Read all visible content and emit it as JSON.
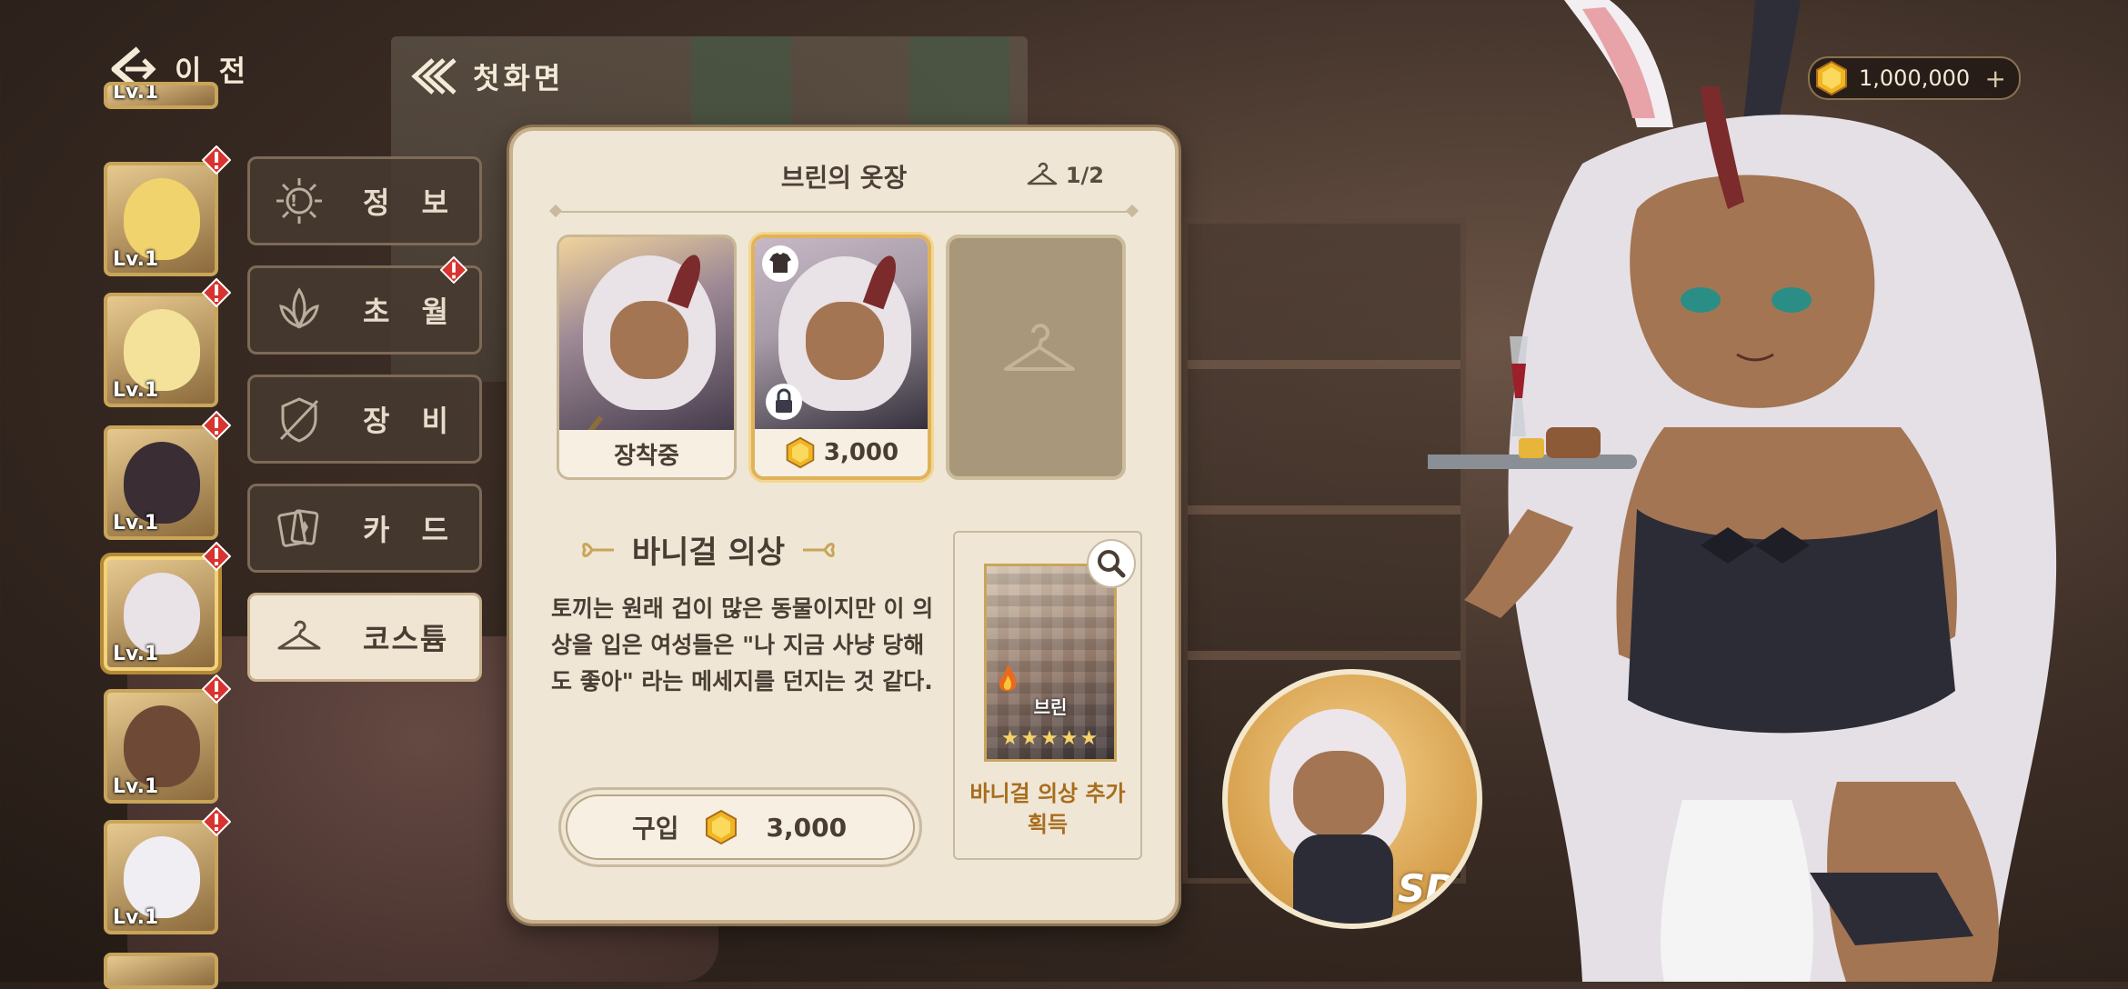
{
  "nav": {
    "back_label": "이 전",
    "home_label": "첫화면"
  },
  "currency": {
    "amount": "1,000,000",
    "plus": "+"
  },
  "characters": [
    {
      "level": "Lv.1"
    },
    {
      "level": "Lv.1"
    },
    {
      "level": "Lv.1"
    },
    {
      "level": "Lv.1"
    },
    {
      "level": "Lv.1"
    },
    {
      "level": "Lv.1"
    },
    {
      "level": "Lv.1"
    }
  ],
  "menu": {
    "info": "정 보",
    "transcend": "초 월",
    "equipment": "장 비",
    "card": "카 드",
    "costume": "코스튬"
  },
  "panel": {
    "title": "브린의 옷장",
    "count": "1/2",
    "costumes": [
      {
        "label": "장착중"
      },
      {
        "price": "3,000"
      }
    ],
    "costume_name": "바니걸 의상",
    "description": "토끼는 원래 겁이 많은 동물이지만 이 의상을 입은 여성들은 \"나 지금 사냥 당해도 좋아\" 라는 메세지를 던지는 것 같다.",
    "buy_label": "구입",
    "buy_price": "3,000",
    "bonus_card_name": "브린",
    "bonus_card_stars": "★★★★★",
    "bonus_text": "바니걸 의상 추가 획득"
  },
  "sd_badge": "SD",
  "colors": {
    "accent": "#c9a55a",
    "panel_bg": "#efe6d6",
    "alert": "#d8332f",
    "bonus_text": "#a86d1c"
  }
}
